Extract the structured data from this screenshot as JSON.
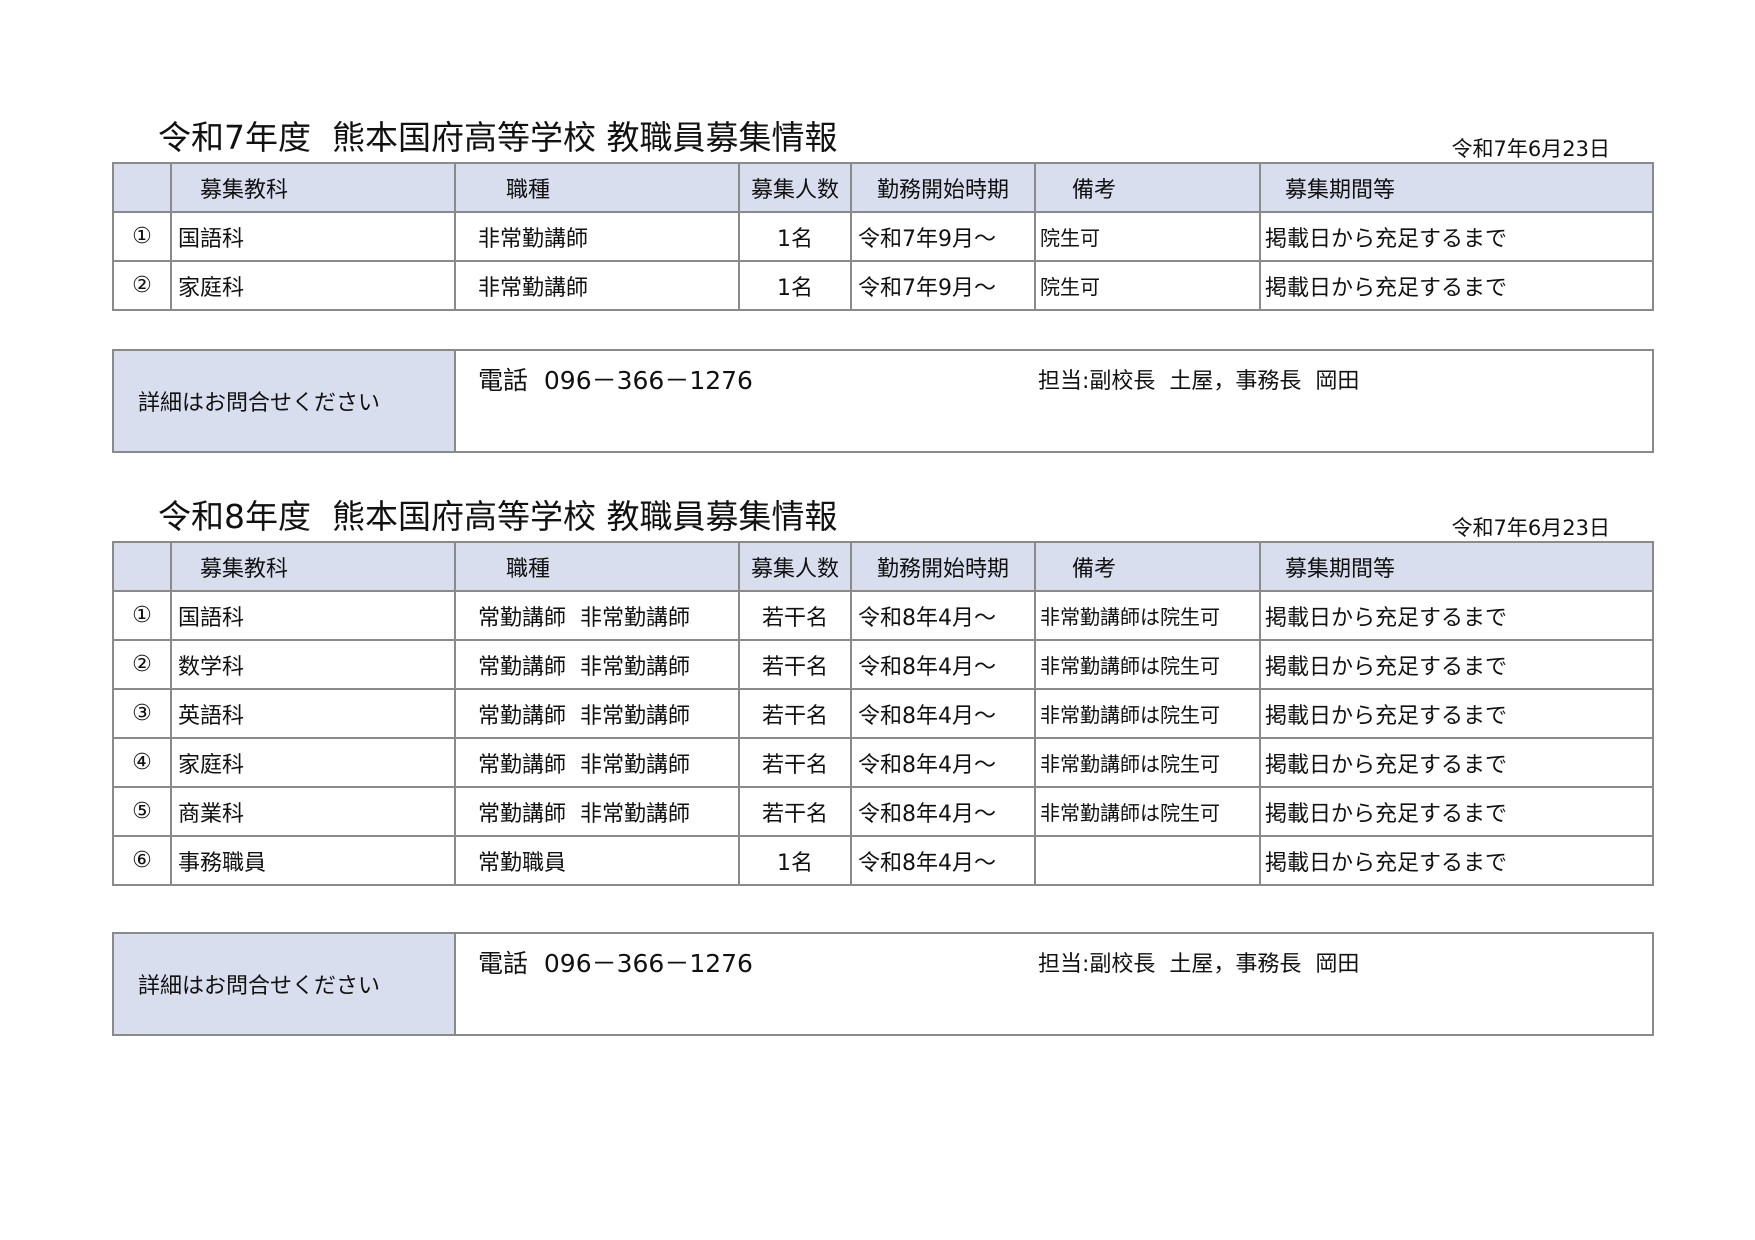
{
  "headers": {
    "no": "",
    "subject": "募集教科",
    "type": "職種",
    "count": "募集人数",
    "start": "勤務開始時期",
    "note": "備考",
    "period": "募集期間等"
  },
  "sections": [
    {
      "title": "令和7年度  熊本国府高等学校 教職員募集情報",
      "date": "令和7年6月23日",
      "rows": [
        {
          "no": "①",
          "subject": "国語科",
          "type": "非常勤講師",
          "count": "1名",
          "start": "令和7年9月～",
          "note": "院生可",
          "period": "掲載日から充足するまで"
        },
        {
          "no": "②",
          "subject": "家庭科",
          "type": "非常勤講師",
          "count": "1名",
          "start": "令和7年9月～",
          "note": "院生可",
          "period": "掲載日から充足するまで"
        }
      ],
      "contact": {
        "label": "詳細はお問合せください",
        "phone": "電話  096－366－1276",
        "person": "担当:副校長  土屋，事務長  岡田"
      }
    },
    {
      "title": "令和8年度  熊本国府高等学校 教職員募集情報",
      "date": "令和7年6月23日",
      "rows": [
        {
          "no": "①",
          "subject": "国語科",
          "type": "常勤講師  非常勤講師",
          "count": "若干名",
          "start": "令和8年4月～",
          "note": "非常勤講師は院生可",
          "period": "掲載日から充足するまで"
        },
        {
          "no": "②",
          "subject": "数学科",
          "type": "常勤講師  非常勤講師",
          "count": "若干名",
          "start": "令和8年4月～",
          "note": "非常勤講師は院生可",
          "period": "掲載日から充足するまで"
        },
        {
          "no": "③",
          "subject": "英語科",
          "type": "常勤講師  非常勤講師",
          "count": "若干名",
          "start": "令和8年4月～",
          "note": "非常勤講師は院生可",
          "period": "掲載日から充足するまで"
        },
        {
          "no": "④",
          "subject": "家庭科",
          "type": "常勤講師  非常勤講師",
          "count": "若干名",
          "start": "令和8年4月～",
          "note": "非常勤講師は院生可",
          "period": "掲載日から充足するまで"
        },
        {
          "no": "⑤",
          "subject": "商業科",
          "type": "常勤講師  非常勤講師",
          "count": "若干名",
          "start": "令和8年4月～",
          "note": "非常勤講師は院生可",
          "period": "掲載日から充足するまで"
        },
        {
          "no": "⑥",
          "subject": "事務職員",
          "type": "常勤職員",
          "count": "1名",
          "start": "令和8年4月～",
          "note": "",
          "period": "掲載日から充足するまで"
        }
      ],
      "contact": {
        "label": "詳細はお問合せください",
        "phone": "電話  096－366－1276",
        "person": "担当:副校長  土屋，事務長  岡田"
      }
    }
  ]
}
